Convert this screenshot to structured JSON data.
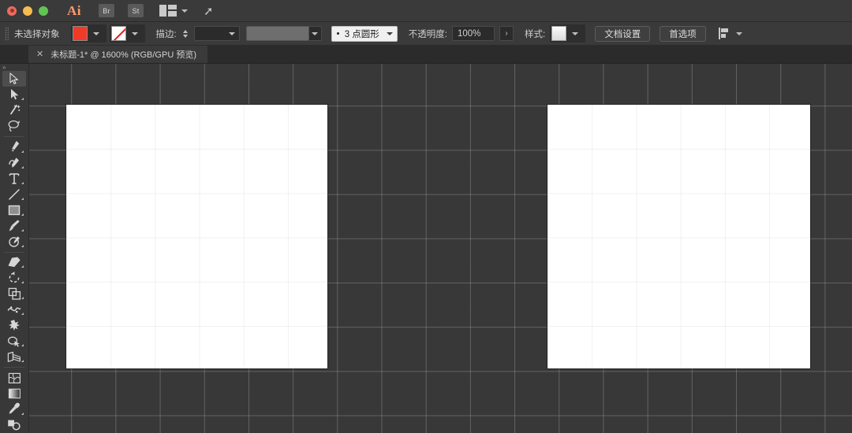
{
  "app": {
    "name": "Adobe Illustrator",
    "logo_text": "Ai",
    "rocket_icon": "rocket-icon"
  },
  "titlebar": {
    "window_controls": [
      {
        "name": "close-button",
        "color": "#ED6A5E"
      },
      {
        "name": "minimize-button",
        "color": "#F5BD4F"
      },
      {
        "name": "maximize-button",
        "color": "#61C454"
      }
    ],
    "bridge_label": "Br",
    "stock_label": "St",
    "arrange_icon": "arrange-documents-icon",
    "arrange_caret": "chevron-down-icon",
    "search_icon": "rocket-icon"
  },
  "controlbar": {
    "selection_status": "未选择对象",
    "fill": {
      "label": "fill-swatch",
      "color": "#F03A28",
      "caret": "chevron-down-icon"
    },
    "stroke_swatch": {
      "label": "stroke-swatch",
      "value": "none",
      "caret": "chevron-down-icon"
    },
    "stroke_label": "描边:",
    "stroke_weight": "",
    "stroke_weight_caret": "chevron-down-icon",
    "variable_width_profile": "",
    "brush_definition": "3 点圆形",
    "opacity_label": "不透明度:",
    "opacity_value": "100%",
    "opacity_expand": "›",
    "style_label": "样式:",
    "document_setup_button": "文档设置",
    "preferences_button": "首选项",
    "align_icon": "align-objects-icon",
    "align_caret": "chevron-down-icon"
  },
  "tabbar": {
    "tabs": [
      {
        "close_icon": "close-icon",
        "title": "未标题-1* @ 1600% (RGB/GPU 预览)"
      }
    ]
  },
  "toolbar": {
    "collapse_handle": "»",
    "tools": [
      {
        "name": "selection-tool",
        "active": true,
        "has_flyout": false
      },
      {
        "name": "direct-selection-tool",
        "active": false,
        "has_flyout": true
      },
      {
        "name": "magic-wand-tool",
        "active": false,
        "has_flyout": false
      },
      {
        "name": "lasso-tool",
        "active": false,
        "has_flyout": false
      },
      {
        "name": "pen-tool",
        "active": false,
        "has_flyout": true
      },
      {
        "name": "curvature-tool",
        "active": false,
        "has_flyout": true
      },
      {
        "name": "type-tool",
        "active": false,
        "has_flyout": true
      },
      {
        "name": "line-segment-tool",
        "active": false,
        "has_flyout": true
      },
      {
        "name": "rectangle-tool",
        "active": false,
        "has_flyout": true
      },
      {
        "name": "paintbrush-tool",
        "active": false,
        "has_flyout": true
      },
      {
        "name": "shaper-pencil-tool",
        "active": false,
        "has_flyout": true
      },
      {
        "name": "eraser-tool",
        "active": false,
        "has_flyout": true
      },
      {
        "name": "rotate-tool",
        "active": false,
        "has_flyout": true
      },
      {
        "name": "scale-tool",
        "active": false,
        "has_flyout": true
      },
      {
        "name": "width-tool",
        "active": false,
        "has_flyout": true
      },
      {
        "name": "free-transform-tool",
        "active": false,
        "has_flyout": false
      },
      {
        "name": "shape-builder-tool",
        "active": false,
        "has_flyout": true
      },
      {
        "name": "perspective-grid-tool",
        "active": false,
        "has_flyout": true
      },
      {
        "name": "mesh-tool",
        "active": false,
        "has_flyout": false
      },
      {
        "name": "gradient-tool",
        "active": false,
        "has_flyout": false
      },
      {
        "name": "eyedropper-tool",
        "active": false,
        "has_flyout": true
      },
      {
        "name": "blend-tool",
        "active": false,
        "has_flyout": false
      }
    ]
  },
  "canvas": {
    "zoom": "1600%",
    "grid_visible": true,
    "artboards": [
      {
        "name": "artboard-1",
        "fill": "#FFFFFF"
      },
      {
        "name": "artboard-2",
        "fill": "#FFFFFF"
      }
    ]
  }
}
